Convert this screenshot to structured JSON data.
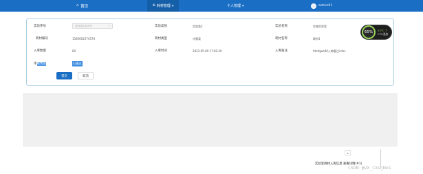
{
  "nav": {
    "home_icon": "home-icon",
    "home_label": "首页",
    "mgmt_label": "耗材管理",
    "personal_label": "个人管理",
    "user_label": "admin01",
    "chevron": "▾",
    "active_color": "#155fa9",
    "bar_color": "#1a6fc4"
  },
  "form": {
    "lab_no_label": "实验序号",
    "lab_no_placeholder": "请选择实验序号",
    "lab_no_caret": "▾",
    "lab_type_label": "实验类别",
    "lab_type_value": "实验类2",
    "lab_name_label": "实验名称",
    "lab_name_value": "生物实验室",
    "mat_no_label": "耗材编号",
    "mat_no_value": "1585602274574",
    "mat_type_label": "耗材类型",
    "mat_type_value": "计量类",
    "mat_name_label": "耗材名称",
    "mat_name_value": "耗材1",
    "qty_label": "入库数量",
    "qty_value": "60",
    "time_label": "入库时间",
    "time_value": "2023-05-09 17:02:30",
    "remark_label": "入库备注",
    "remark_value": "fdmfgaefkf入库备注infes",
    "status_label_a": "审",
    "status_label_b": "核状态",
    "status_value": "已通过",
    "submit_label": "提交",
    "cancel_label": "取消"
  },
  "gauge": {
    "percent_text": "65%",
    "percent_value": 65,
    "line1": "53°C ↑",
    "line2": "CPU温度"
  },
  "bottom": {
    "marker": "▾",
    "toast": "实验室耗材入库信息 查看详情(#1)",
    "watermark": "CSDN @VX_CXsjNo1"
  }
}
